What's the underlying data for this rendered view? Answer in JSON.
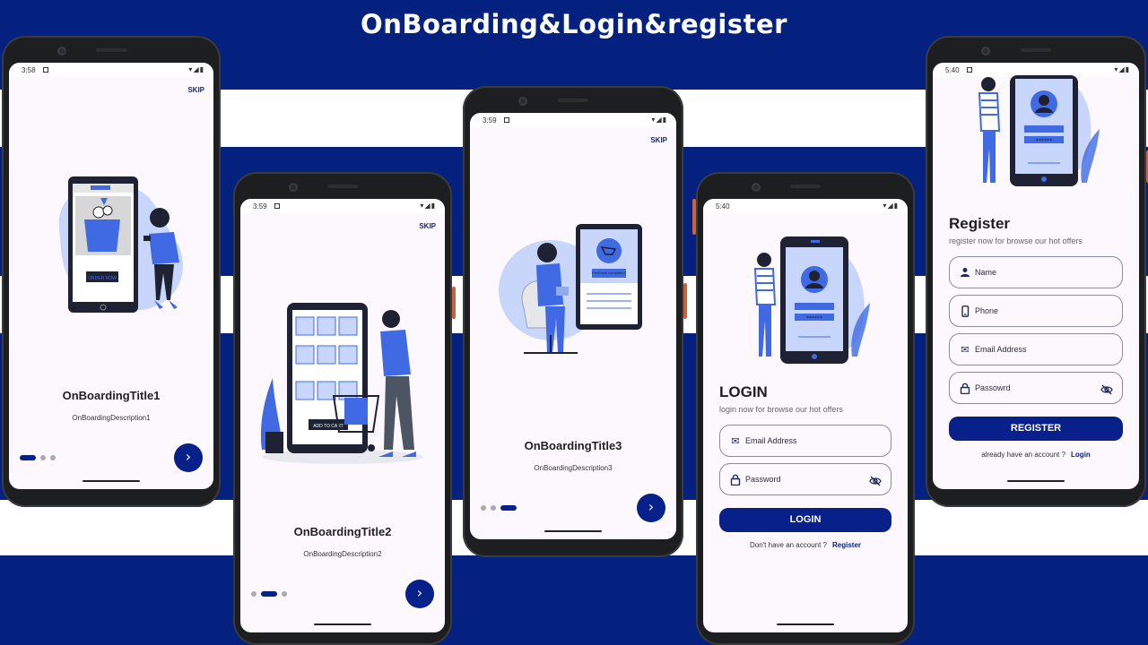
{
  "banner": {
    "title": "OnBoarding&Login&register"
  },
  "colors": {
    "primary": "#07208a",
    "stripe": "#04217f",
    "illustration_blue": "#3f6ae3",
    "illustration_light": "#c8d6fb"
  },
  "phones": {
    "onboarding1": {
      "time": "3:58",
      "skip": "SKIP",
      "title": "OnBoardingTitle1",
      "description": "OnBoardingDescription1",
      "active_page": 1,
      "illus_caption": "ORDER NOW"
    },
    "onboarding2": {
      "time": "3:59",
      "skip": "SKIP",
      "title": "OnBoardingTitle2",
      "description": "OnBoardingDescription2",
      "active_page": 2,
      "illus_caption": "ADD TO CART"
    },
    "onboarding3": {
      "time": "3:59",
      "skip": "SKIP",
      "title": "OnBoardingTitle3",
      "description": "OnBoardingDescription3",
      "active_page": 3,
      "illus_caption": "Purchase completed!"
    },
    "login": {
      "time": "5:40",
      "title": "LOGIN",
      "subtitle": "login now for browse our hot offers",
      "fields": {
        "email": "Email Address",
        "password": "Password"
      },
      "button": "LOGIN",
      "alt_text": "Don't have an account ?",
      "alt_link": "Register"
    },
    "register": {
      "time": "5:40",
      "title": "Register",
      "subtitle": "register now for browse our hot offers",
      "fields": {
        "name": "Name",
        "phone": "Phone",
        "email": "Email Address",
        "password": "Passowrd"
      },
      "button": "REGISTER",
      "alt_text": "already have an account ?",
      "alt_link": "Login"
    }
  },
  "icons": {
    "next": "chevron-right-icon",
    "email": "envelope-icon",
    "password": "lock-icon",
    "name": "person-icon",
    "phone": "phone-icon",
    "visibility": "eye-off-icon"
  }
}
